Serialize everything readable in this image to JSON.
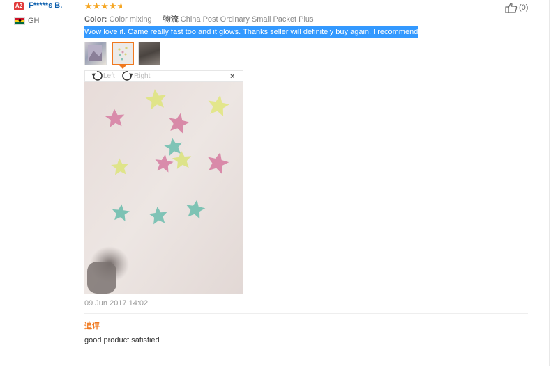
{
  "reviewer": {
    "level_badge": "A2",
    "name": "F*****s B.",
    "country_code": "GH"
  },
  "rating": {
    "stars": 4.5,
    "max": 5,
    "star_glyphs": "★★★★"
  },
  "helpful": {
    "count": "(0)"
  },
  "attributes": {
    "color_key": "Color:",
    "color_value": "Color mixing",
    "logistics_key": "物流",
    "logistics_value": "China Post Ordinary Small Packet Plus"
  },
  "review_text": "Wow love it. Came really fast too and it glows. Thanks seller will definitely buy again. I recommend",
  "viewer": {
    "rotate_left_label": "Left",
    "rotate_right_label": "Right",
    "close_symbol": "×"
  },
  "date": "09 Jun 2017 14:02",
  "followup": {
    "label": "追评",
    "text": "good product satisfied"
  },
  "colors": {
    "highlight": "#3399ff",
    "accent": "#f0791f",
    "star": "#f5a623",
    "link": "#0c5fae"
  },
  "icons": [
    "thumbs-up-icon",
    "rotate-left-icon",
    "rotate-right-icon",
    "close-icon",
    "flag-icon"
  ]
}
